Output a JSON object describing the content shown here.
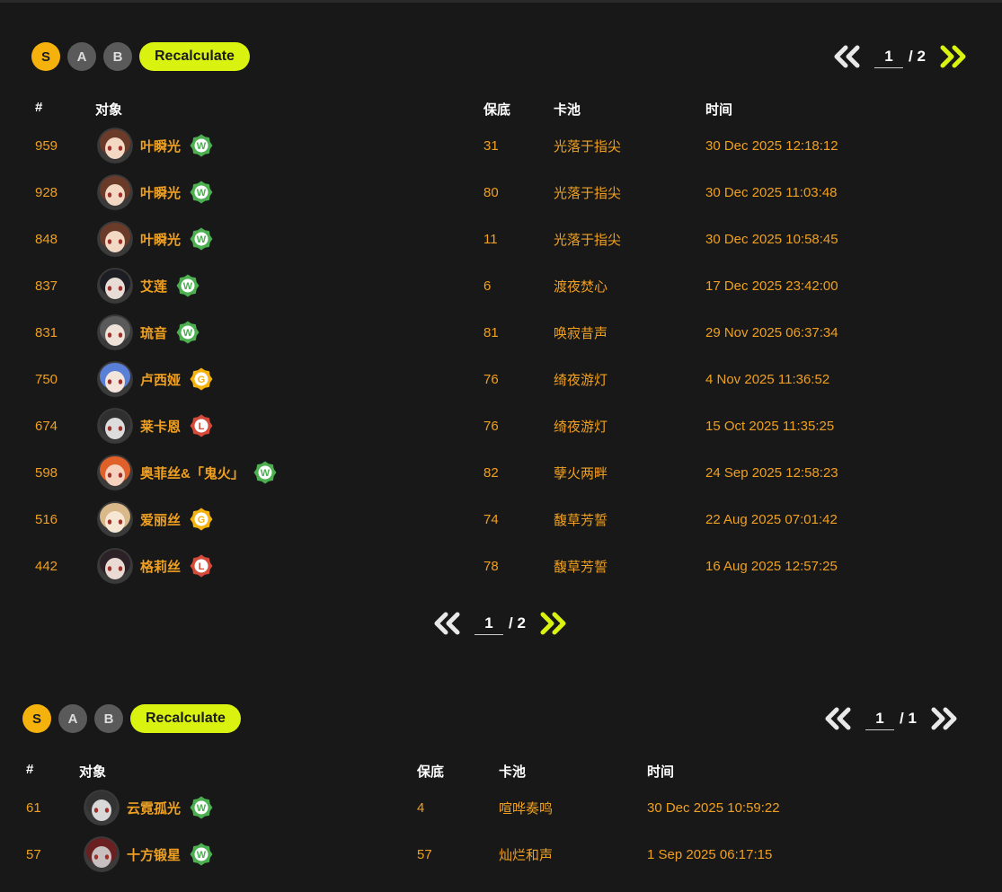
{
  "colors": {
    "accent": "#d9f20f",
    "rank_s": "#f5b20d",
    "text": "#f0a020",
    "badge_w": "#4caf50",
    "badge_g": "#f5b20d",
    "badge_l": "#d64a3a"
  },
  "sections": [
    {
      "ranks": [
        "S",
        "A",
        "B"
      ],
      "recalculate_label": "Recalculate",
      "headers": {
        "num": "#",
        "target": "对象",
        "pity": "保底",
        "pool": "卡池",
        "time": "时间"
      },
      "pager_top": {
        "page": "1",
        "total": "/ 2"
      },
      "pager_bottom": {
        "page": "1",
        "total": "/ 2"
      },
      "rows": [
        {
          "num": "959",
          "name": "叶瞬光",
          "badge": "W",
          "pity": "31",
          "pool": "光落于指尖",
          "time": "30 Dec 2025 12:18:12"
        },
        {
          "num": "928",
          "name": "叶瞬光",
          "badge": "W",
          "pity": "80",
          "pool": "光落于指尖",
          "time": "30 Dec 2025 11:03:48"
        },
        {
          "num": "848",
          "name": "叶瞬光",
          "badge": "W",
          "pity": "11",
          "pool": "光落于指尖",
          "time": "30 Dec 2025 10:58:45"
        },
        {
          "num": "837",
          "name": "艾莲",
          "badge": "W",
          "pity": "6",
          "pool": "渡夜焚心",
          "time": "17 Dec 2025 23:42:00"
        },
        {
          "num": "831",
          "name": "琉音",
          "badge": "W",
          "pity": "81",
          "pool": "唤寂昔声",
          "time": "29 Nov 2025 06:37:34"
        },
        {
          "num": "750",
          "name": "卢西娅",
          "badge": "G",
          "pity": "76",
          "pool": "绮夜游灯",
          "time": "4 Nov 2025 11:36:52"
        },
        {
          "num": "674",
          "name": "莱卡恩",
          "badge": "L",
          "pity": "76",
          "pool": "绮夜游灯",
          "time": "15 Oct 2025 11:35:25"
        },
        {
          "num": "598",
          "name": "奥菲丝&「鬼火」",
          "badge": "W",
          "pity": "82",
          "pool": "孽火两畔",
          "time": "24 Sep 2025 12:58:23"
        },
        {
          "num": "516",
          "name": "爱丽丝",
          "badge": "G",
          "pity": "74",
          "pool": "馥草芳誓",
          "time": "22 Aug 2025 07:01:42"
        },
        {
          "num": "442",
          "name": "格莉丝",
          "badge": "L",
          "pity": "78",
          "pool": "馥草芳誓",
          "time": "16 Aug 2025 12:57:25"
        }
      ]
    },
    {
      "ranks": [
        "S",
        "A",
        "B"
      ],
      "recalculate_label": "Recalculate",
      "headers": {
        "num": "#",
        "target": "对象",
        "pity": "保底",
        "pool": "卡池",
        "time": "时间"
      },
      "pager_top": {
        "page": "1",
        "total": "/ 1"
      },
      "rows": [
        {
          "num": "61",
          "name": "云霓孤光",
          "badge": "W",
          "pity": "4",
          "pool": "喧哗奏鸣",
          "time": "30 Dec 2025 10:59:22"
        },
        {
          "num": "57",
          "name": "十方锻星",
          "badge": "W",
          "pity": "57",
          "pool": "灿烂和声",
          "time": "1 Sep 2025 06:17:15"
        }
      ]
    }
  ]
}
